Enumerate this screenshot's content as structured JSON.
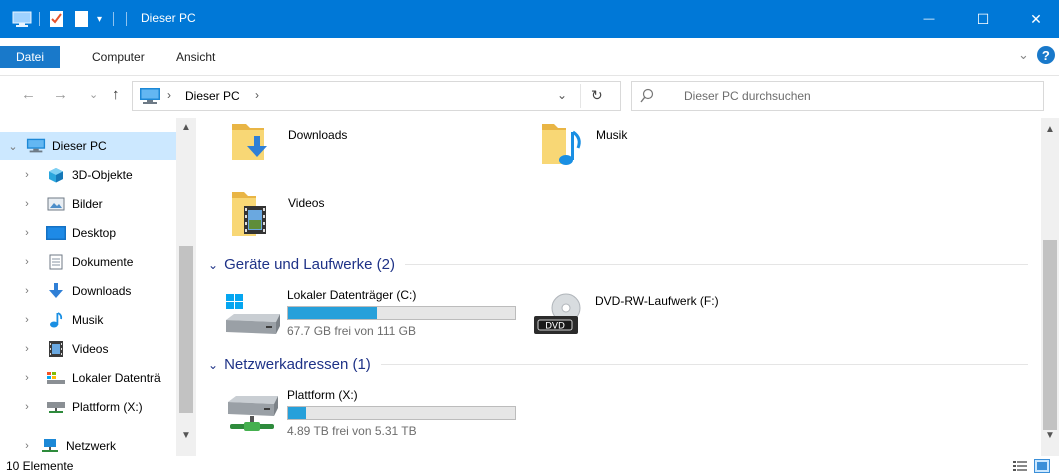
{
  "window": {
    "title": "Dieser PC",
    "minimize_glyph": "—",
    "maximize_glyph": "☐",
    "close_glyph": "✕",
    "accent": "#0078d7"
  },
  "ribbon": {
    "tabs": [
      "Datei",
      "Computer",
      "Ansicht"
    ],
    "expand_glyph": "⌄",
    "help_glyph": "?"
  },
  "address": {
    "back_glyph": "←",
    "forward_glyph": "→",
    "recent_glyph": "⌄",
    "up_glyph": "↑",
    "separator_glyph": "›",
    "path": [
      "Dieser PC"
    ],
    "dropdown_glyph": "⌄",
    "refresh_glyph": "↻"
  },
  "search": {
    "placeholder": "Dieser PC durchsuchen",
    "icon": "search-icon"
  },
  "navigation": {
    "items": [
      {
        "label": "Dieser PC",
        "icon": "computer-icon",
        "expanded": true,
        "selected": true
      },
      {
        "label": "3D-Objekte",
        "icon": "3d-objects-icon"
      },
      {
        "label": "Bilder",
        "icon": "pictures-icon"
      },
      {
        "label": "Desktop",
        "icon": "desktop-icon"
      },
      {
        "label": "Dokumente",
        "icon": "documents-icon"
      },
      {
        "label": "Downloads",
        "icon": "downloads-icon"
      },
      {
        "label": "Musik",
        "icon": "music-icon"
      },
      {
        "label": "Videos",
        "icon": "videos-icon"
      },
      {
        "label": "Lokaler Datenträ",
        "icon": "local-disk-icon"
      },
      {
        "label": "Plattform (X:)",
        "icon": "network-drive-icon"
      },
      {
        "label": "Netzwerk",
        "icon": "network-icon"
      }
    ]
  },
  "content": {
    "folders": [
      {
        "label": "Downloads",
        "icon": "downloads-folder-icon"
      },
      {
        "label": "Musik",
        "icon": "music-folder-icon"
      },
      {
        "label": "Videos",
        "icon": "videos-folder-icon"
      }
    ],
    "groups": [
      {
        "title": "Geräte und Laufwerke (2)",
        "drives": [
          {
            "name": "Lokaler Datenträger (C:)",
            "free_text": "67.7 GB frei von 111 GB",
            "used_fraction": 0.39,
            "icon": "windows-drive-icon"
          },
          {
            "name": "DVD-RW-Laufwerk (F:)",
            "free_text": "",
            "icon": "dvd-drive-icon",
            "badge": "DVD"
          }
        ]
      },
      {
        "title": "Netzwerkadressen (1)",
        "drives": [
          {
            "name": "Plattform (X:)",
            "free_text": "4.89 TB frei von 5.31 TB",
            "used_fraction": 0.08,
            "icon": "network-drive-icon"
          }
        ]
      }
    ],
    "bar_color": "#26a0da"
  },
  "status": {
    "count": "10 Elemente"
  }
}
